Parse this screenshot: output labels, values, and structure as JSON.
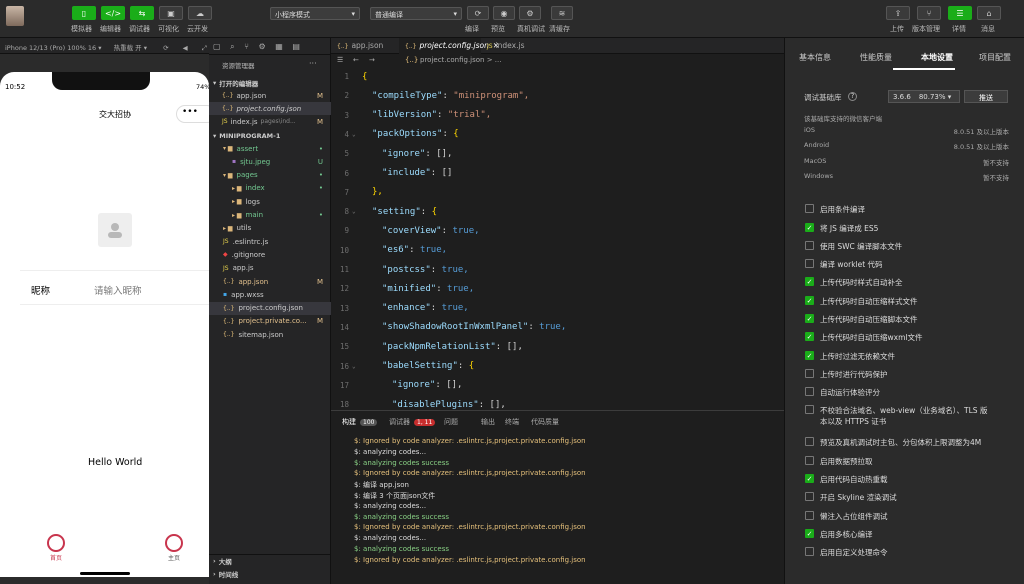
{
  "toolbar": {
    "left_buttons": [
      {
        "label": "模拟器",
        "icon": "phone-icon"
      },
      {
        "label": "编辑器",
        "icon": "code-icon"
      },
      {
        "label": "调试器",
        "icon": "debug-icon"
      },
      {
        "label": "可视化",
        "icon": "visual-icon"
      },
      {
        "label": "云开发",
        "icon": "cloud-icon"
      }
    ],
    "mode_select": "小程序模式",
    "compile_select": "普通编译",
    "mid_buttons": [
      {
        "label": "编译",
        "icon": "refresh-icon"
      },
      {
        "label": "预览",
        "icon": "eye-icon"
      },
      {
        "label": "真机调试",
        "icon": "device-icon"
      },
      {
        "label": "清缓存",
        "icon": "layers-icon"
      }
    ],
    "right_buttons": [
      {
        "label": "上传",
        "icon": "upload-icon"
      },
      {
        "label": "版本管理",
        "icon": "branch-icon"
      },
      {
        "label": "详情",
        "icon": "menu-icon"
      },
      {
        "label": "消息",
        "icon": "bell-icon"
      }
    ]
  },
  "simulator": {
    "device": "iPhone 12/13 (Pro) 100% 16 ▾",
    "hot_reload": "热重载 开 ▾",
    "time": "10:52",
    "battery": "74%",
    "nav_title": "交大招协",
    "nickname_label": "昵称",
    "nickname_placeholder": "请输入昵称",
    "hello": "Hello World",
    "tabbar": [
      {
        "label": "首页"
      },
      {
        "label": "主页"
      }
    ]
  },
  "explorer": {
    "title": "资源管理器",
    "open_editors_header": "打开的编辑器",
    "open_editors": [
      {
        "name": "app.json",
        "badge": "M",
        "icon": "{..}"
      },
      {
        "name": "project.config.json",
        "badge": "",
        "icon": "{..}"
      },
      {
        "name": "index.js",
        "extra": "pages\\ind...",
        "badge": "M",
        "icon": "JS"
      }
    ],
    "project_header": "MINIPROGRAM-1",
    "tree": [
      {
        "name": "assert",
        "indent": 1,
        "type": "folder",
        "badge": "•"
      },
      {
        "name": "sjtu.jpeg",
        "indent": 2,
        "type": "img",
        "badge": "U"
      },
      {
        "name": "pages",
        "indent": 1,
        "type": "folder",
        "badge": "•"
      },
      {
        "name": "index",
        "indent": 2,
        "type": "folder",
        "badge": "•"
      },
      {
        "name": "logs",
        "indent": 2,
        "type": "folder",
        "badge": ""
      },
      {
        "name": "main",
        "indent": 2,
        "type": "folder",
        "badge": "•"
      },
      {
        "name": "utils",
        "indent": 1,
        "type": "folder",
        "badge": ""
      },
      {
        "name": ".eslintrc.js",
        "indent": 1,
        "type": "js",
        "badge": ""
      },
      {
        "name": ".gitignore",
        "indent": 1,
        "type": "git",
        "badge": ""
      },
      {
        "name": "app.js",
        "indent": 1,
        "type": "js",
        "badge": ""
      },
      {
        "name": "app.json",
        "indent": 1,
        "type": "json",
        "badge": "M"
      },
      {
        "name": "app.wxss",
        "indent": 1,
        "type": "wxss",
        "badge": ""
      },
      {
        "name": "project.config.json",
        "indent": 1,
        "type": "json",
        "badge": ""
      },
      {
        "name": "project.private.co...",
        "indent": 1,
        "type": "json",
        "badge": "M"
      },
      {
        "name": "sitemap.json",
        "indent": 1,
        "type": "json",
        "badge": ""
      }
    ],
    "outline": "大纲",
    "timeline": "时间线"
  },
  "editor": {
    "tabs": [
      {
        "name": "app.json",
        "icon": "{..}"
      },
      {
        "name": "project.config.json",
        "icon": "{..}",
        "active": true
      },
      {
        "name": "index.js",
        "icon": "JS"
      }
    ],
    "breadcrumb": "project.config.json > ...",
    "lines": [
      {
        "n": "1",
        "k": "",
        "v": "{"
      },
      {
        "n": "2",
        "k": "\"compileType\"",
        "v": "\"miniprogram\","
      },
      {
        "n": "3",
        "k": "\"libVersion\"",
        "v": "\"trial\","
      },
      {
        "n": "4",
        "k": "\"packOptions\"",
        "v": "{"
      },
      {
        "n": "5",
        "k": "\"ignore\"",
        "v": "[],"
      },
      {
        "n": "6",
        "k": "\"include\"",
        "v": "[]"
      },
      {
        "n": "7",
        "k": "",
        "v": "},"
      },
      {
        "n": "8",
        "k": "\"setting\"",
        "v": "{"
      },
      {
        "n": "9",
        "k": "\"coverView\"",
        "v": "true,"
      },
      {
        "n": "10",
        "k": "\"es6\"",
        "v": "true,"
      },
      {
        "n": "11",
        "k": "\"postcss\"",
        "v": "true,"
      },
      {
        "n": "12",
        "k": "\"minified\"",
        "v": "true,"
      },
      {
        "n": "13",
        "k": "\"enhance\"",
        "v": "true,"
      },
      {
        "n": "14",
        "k": "\"showShadowRootInWxmlPanel\"",
        "v": "true,"
      },
      {
        "n": "15",
        "k": "\"packNpmRelationList\"",
        "v": "[],"
      },
      {
        "n": "16",
        "k": "\"babelSetting\"",
        "v": "{"
      },
      {
        "n": "17",
        "k": "\"ignore\"",
        "v": "[],"
      },
      {
        "n": "18",
        "k": "\"disablePlugins\"",
        "v": "[],"
      }
    ]
  },
  "console": {
    "tabs": [
      {
        "label": "构建",
        "count": "100"
      },
      {
        "label": "调试器",
        "count": "1, 11"
      },
      {
        "label": "问题"
      },
      {
        "label": "输出"
      },
      {
        "label": "终端"
      },
      {
        "label": "代码质量"
      }
    ],
    "lines": [
      {
        "t": "$: Ignored by code analyzer: .eslintrc.js,project.private.config.json",
        "c": "yel"
      },
      {
        "t": "$: analyzing codes...",
        "c": ""
      },
      {
        "t": "$: analyzing codes success",
        "c": "g"
      },
      {
        "t": "$: Ignored by code analyzer: .eslintrc.js,project.private.config.json",
        "c": "yel"
      },
      {
        "t": "$: 编译 app.json",
        "c": ""
      },
      {
        "t": "$: 编译 3 个页面json文件",
        "c": ""
      },
      {
        "t": "$: analyzing codes...",
        "c": ""
      },
      {
        "t": "$: analyzing codes success",
        "c": "g"
      },
      {
        "t": "$: Ignored by code analyzer: .eslintrc.js,project.private.config.json",
        "c": "yel"
      },
      {
        "t": "$: analyzing codes...",
        "c": ""
      },
      {
        "t": "$: analyzing codes success",
        "c": "g"
      },
      {
        "t": "$: Ignored by code analyzer: .eslintrc.js,project.private.config.json",
        "c": "yel"
      }
    ]
  },
  "panel": {
    "tabs": [
      {
        "label": "基本信息"
      },
      {
        "label": "性能质量"
      },
      {
        "label": "本地设置",
        "active": true
      },
      {
        "label": "项目配置"
      }
    ],
    "lib_label": "调试基础库",
    "lib_version": "3.6.6",
    "lib_percent": "80.73% ▾",
    "push_button": "推送",
    "lib_note": "该基础库支持的微信客户端",
    "platforms": [
      {
        "name": "iOS",
        "value": "8.0.51 及以上版本"
      },
      {
        "name": "Android",
        "value": "8.0.51 及以上版本"
      },
      {
        "name": "MacOS",
        "value": "暂不支持"
      },
      {
        "name": "Windows",
        "value": "暂不支持"
      }
    ],
    "options": [
      {
        "label": "启用条件编译",
        "checked": false
      },
      {
        "label": "将 JS 编译成 ES5",
        "checked": true
      },
      {
        "label": "使用 SWC 编译脚本文件",
        "checked": false
      },
      {
        "label": "编译 worklet 代码",
        "checked": false
      },
      {
        "label": "上传代码时样式自动补全",
        "checked": true
      },
      {
        "label": "上传代码时自动压缩样式文件",
        "checked": true
      },
      {
        "label": "上传代码时自动压缩脚本文件",
        "checked": true
      },
      {
        "label": "上传代码时自动压缩wxml文件",
        "checked": true
      },
      {
        "label": "上传时过滤无依赖文件",
        "checked": true
      },
      {
        "label": "上传时进行代码保护",
        "checked": false
      },
      {
        "label": "自动运行体验评分",
        "checked": false
      },
      {
        "label": "不校验合法域名、web-view（业务域名）、TLS 版",
        "label2": "本以及 HTTPS 证书",
        "checked": false
      },
      {
        "label": "预览及真机调试时主包、分包体积上限调整为4M",
        "checked": false
      },
      {
        "label": "启用数据预拉取",
        "checked": false
      },
      {
        "label": "启用代码自动热重载",
        "checked": true
      },
      {
        "label": "开启 Skyline 渲染调试",
        "checked": false
      },
      {
        "label": "懒注入占位组件调试",
        "checked": false
      },
      {
        "label": "启用多核心编译",
        "checked": true
      },
      {
        "label": "启用自定义处理命令",
        "checked": false
      }
    ]
  }
}
